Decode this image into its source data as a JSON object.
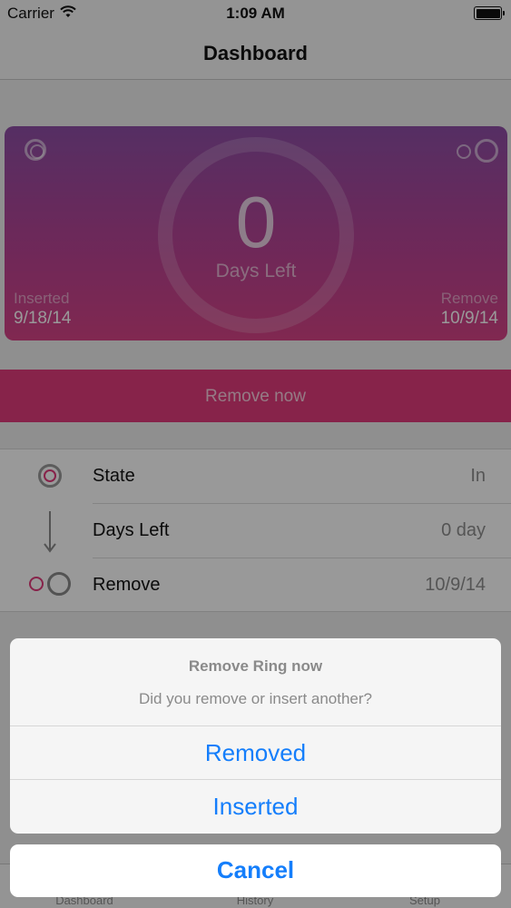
{
  "status_bar": {
    "carrier": "Carrier",
    "time": "1:09 AM"
  },
  "nav": {
    "title": "Dashboard"
  },
  "card": {
    "days_left_number": "0",
    "days_left_caption": "Days Left",
    "inserted_label": "Inserted",
    "inserted_date": "9/18/14",
    "remove_label": "Remove",
    "remove_date": "10/9/14",
    "colors": {
      "gradient_top": "#8e4fa6",
      "gradient_bottom": "#d64386"
    }
  },
  "remove_now": {
    "label": "Remove now",
    "color": "#e23b7c"
  },
  "info": [
    {
      "icon": "ring-state-icon",
      "label": "State",
      "value": "In"
    },
    {
      "icon": "down-arrow-icon",
      "label": "Days Left",
      "value": "0 day"
    },
    {
      "icon": "remove-rings-icon",
      "label": "Remove",
      "value": "10/9/14"
    }
  ],
  "tabs": [
    {
      "label": "Dashboard"
    },
    {
      "label": "History"
    },
    {
      "label": "Setup"
    }
  ],
  "action_sheet": {
    "title": "Remove Ring now",
    "message": "Did you remove or insert another?",
    "buttons": [
      {
        "label": "Removed"
      },
      {
        "label": "Inserted"
      }
    ],
    "cancel": "Cancel",
    "accent_color": "#147efb"
  }
}
